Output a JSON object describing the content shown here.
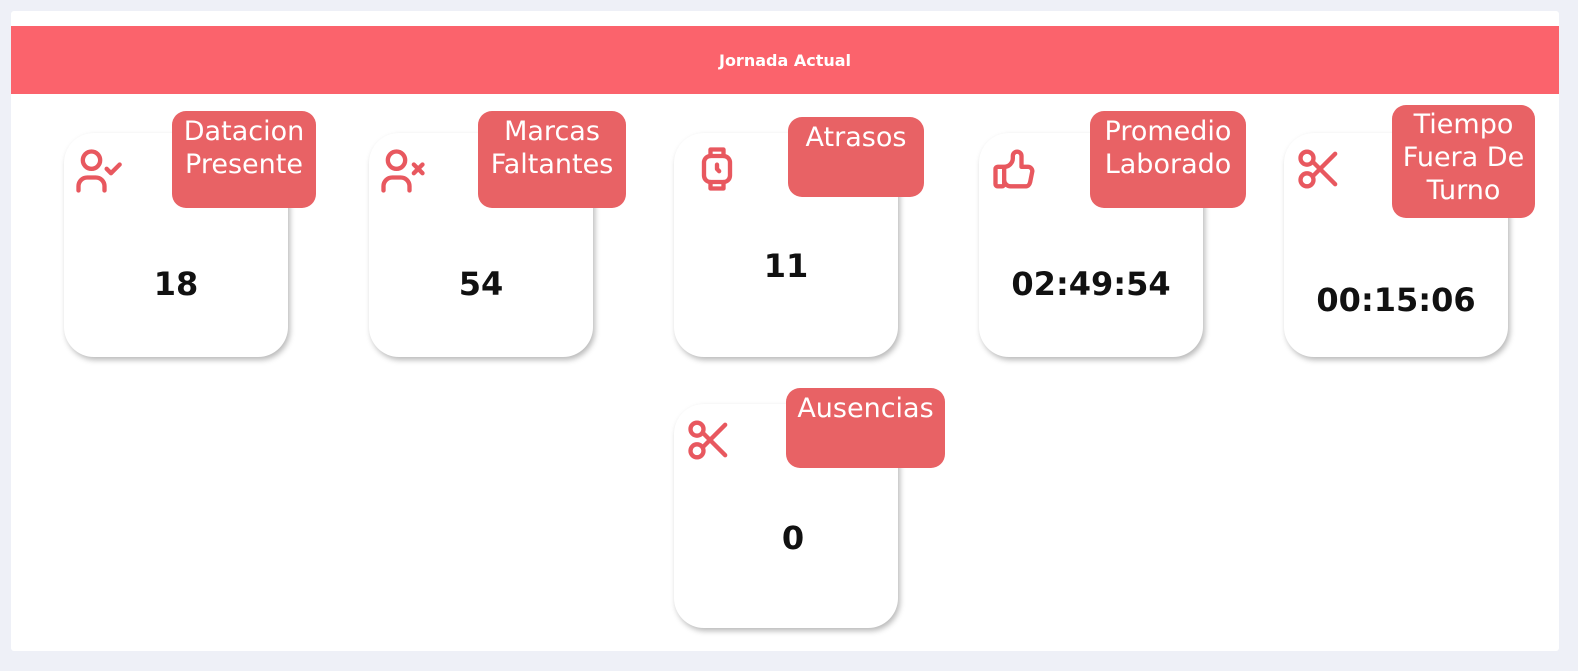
{
  "header": {
    "title": "Jornada Actual"
  },
  "colors": {
    "accent": "#fb636c",
    "tag": "#e86265",
    "icon": "#e8585f"
  },
  "cards": [
    {
      "label": "Datacion\nPresente",
      "value": "18",
      "icon": "user-check-icon"
    },
    {
      "label": "Marcas\nFaltantes",
      "value": "54",
      "icon": "user-x-icon"
    },
    {
      "label": "Atrasos",
      "value": "11",
      "icon": "watch-icon"
    },
    {
      "label": "Promedio\nLaborado",
      "value": "02:49:54",
      "icon": "thumbs-up-icon"
    },
    {
      "label": "Tiempo\nFuera De\nTurno",
      "value": "00:15:06",
      "icon": "scissors-icon"
    },
    {
      "label": "Ausencias",
      "value": "0",
      "icon": "scissors-icon"
    }
  ]
}
